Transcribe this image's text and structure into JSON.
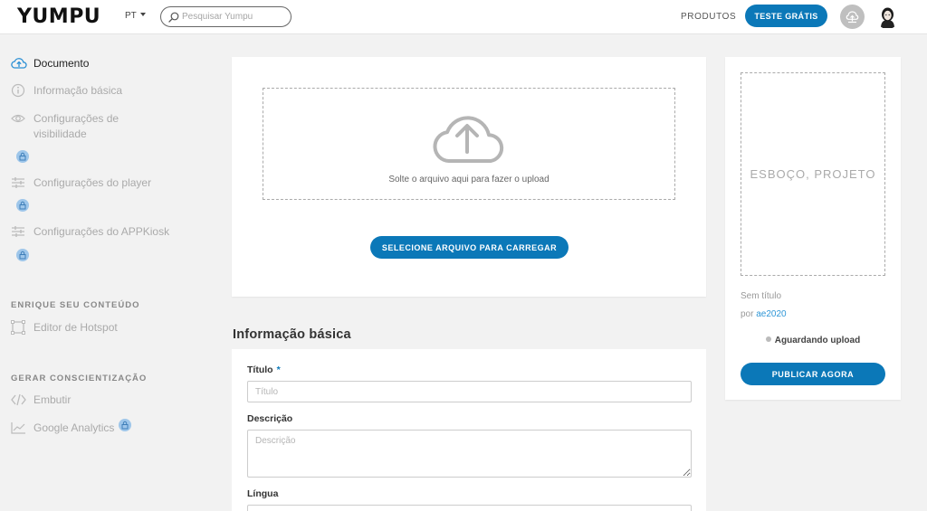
{
  "header": {
    "logo": "YUMPU",
    "language": "PT",
    "search_placeholder": "Pesquisar Yumpu",
    "products": "PRODUTOS",
    "trial_button": "TESTE GRÁTIS",
    "icons": [
      "search-icon",
      "upload-icon",
      "avatar"
    ]
  },
  "sidebar": {
    "items": [
      {
        "label": "Documento",
        "icon": "cloud-upload-icon",
        "active": true
      },
      {
        "label": "Informação básica",
        "icon": "info-icon"
      },
      {
        "label": "Configurações de visibilidade",
        "icon": "eye-icon",
        "locked": true
      },
      {
        "label": "Configurações do player",
        "icon": "sliders-icon",
        "locked": true
      },
      {
        "label": "Configurações do APPKiosk",
        "icon": "sliders-icon",
        "locked": true
      }
    ],
    "section_enrich": "ENRIQUE SEU CONTEÚDO",
    "hotspot_editor": "Editor de Hotspot",
    "section_awareness": "GERAR CONSCIENTIZAÇÃO",
    "embed": "Embutir",
    "google_analytics": "Google Analytics"
  },
  "upload": {
    "drop_text": "Solte o arquivo aqui para fazer o upload",
    "select_button": "SELECIONE ARQUIVO PARA CARREGAR"
  },
  "basic_info": {
    "section_title": "Informação básica",
    "title_label": "Título",
    "required_mark": "*",
    "title_placeholder": "Título",
    "description_label": "Descrição",
    "description_placeholder": "Descrição",
    "language_label": "Língua"
  },
  "preview": {
    "placeholder_text": "ESBOÇO, PROJETO",
    "untitled": "Sem título",
    "by": "por",
    "author": "ae2020",
    "status": "Aguardando upload",
    "publish_button": "PUBLICAR AGORA"
  },
  "colors": {
    "accent": "#0b78b8",
    "link": "#2e96d6",
    "lock_badge": "#9ec6ea"
  }
}
